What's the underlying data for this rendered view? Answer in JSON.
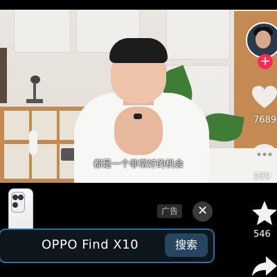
{
  "video": {
    "subtitle": "都是一个非常好的机会"
  },
  "sidebar": {
    "follow_label": "+",
    "like_count": "7689",
    "comment_count": "989",
    "favorite_count": "546"
  },
  "ad": {
    "badge": "广告",
    "close_label": "✕",
    "product_name": "OPPO Find X10",
    "search_label": "搜索"
  },
  "colors": {
    "follow_red": "#fe2c55",
    "ad_border": "#2a6f9f",
    "search_button": "#26465f"
  },
  "icons": [
    "heart-icon",
    "comment-icon",
    "star-icon",
    "share-icon",
    "close-icon"
  ]
}
